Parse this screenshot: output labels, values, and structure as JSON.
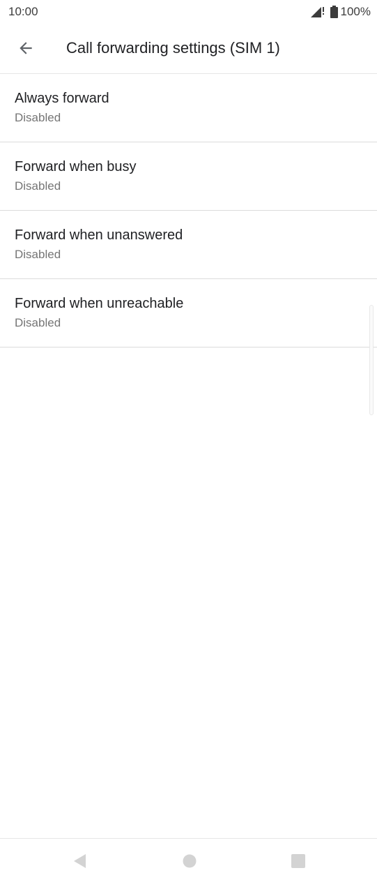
{
  "status_bar": {
    "time": "10:00",
    "battery_percent": "100%",
    "icons": [
      "signal-icon",
      "battery-icon"
    ]
  },
  "app_bar": {
    "title": "Call forwarding settings (SIM 1)",
    "back_icon": "arrow-left-icon"
  },
  "settings": {
    "items": [
      {
        "title": "Always forward",
        "summary": "Disabled"
      },
      {
        "title": "Forward when busy",
        "summary": "Disabled"
      },
      {
        "title": "Forward when unanswered",
        "summary": "Disabled"
      },
      {
        "title": "Forward when unreachable",
        "summary": "Disabled"
      }
    ]
  },
  "nav_bar": {
    "icons": [
      "nav-back-icon",
      "nav-home-icon",
      "nav-recents-icon"
    ]
  },
  "colors": {
    "text_primary": "#202124",
    "text_secondary": "#757575",
    "divider": "#dcdcdc",
    "nav_icon": "#d3d3d3"
  }
}
